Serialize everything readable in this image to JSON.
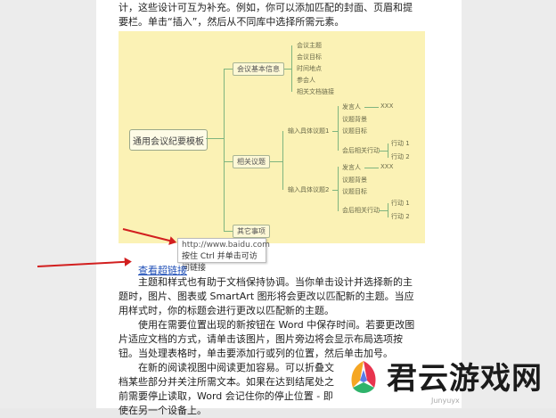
{
  "paragraphs": {
    "p1": "计，这些设计可互为补充。例如，你可以添加匹配的封面、页眉和提要栏。单击“插入”，然后从不同库中选择所需元素。",
    "p2": "主题和样式也有助于文档保持协调。当你单击设计并选择新的主题时，图片、图表或 SmartArt 图形将会更改以匹配新的主题。当应用样式时，你的标题会进行更改以匹配新的主题。",
    "p3": "使用在需要位置出现的新按钮在 Word 中保存时间。若要更改图片适应文档的方式，请单击该图片，图片旁边将会显示布局选项按钮。当处理表格时，单击要添加行或列的位置，然后单击加号。",
    "p4": "在新的阅读视图中阅读更加容易。可以折叠文档某些部分并关注所需文本。如果在达到结尾处之前需要停止读取，Word 会记住你的停止位置 - 即使在另一个设备上。"
  },
  "mindmap": {
    "root": "通用会议纪要模板",
    "branch1": {
      "label": "会议基本信息",
      "items": [
        "会议主题",
        "会议目标",
        "时间地点",
        "参会人",
        "相关文档链接"
      ]
    },
    "branch2": {
      "label": "相关议题",
      "topic1": {
        "label": "输入具体议题1",
        "items": [
          "发言人",
          "议题背景",
          "议题目标",
          "会后相关行动"
        ],
        "speaker_value": "XXX",
        "actions": [
          "行动 1",
          "行动 2"
        ]
      },
      "topic2": {
        "label": "输入具体议题2",
        "items": [
          "发言人",
          "议题背景",
          "议题目标",
          "会后相关行动"
        ],
        "speaker_value": "XXX",
        "actions": [
          "行动 1",
          "行动 2"
        ]
      }
    },
    "branch3": {
      "label": "其它事项"
    }
  },
  "tooltip": {
    "url": "http://www.baidu.com",
    "hint": "按住 Ctrl 并单击可访问链接"
  },
  "link_text": "查看超链接",
  "watermark": {
    "brand": "君云游戏网",
    "sub": "Junyuyx"
  },
  "colors": {
    "mindmap_bg": "#fbf2b5",
    "link": "#1f4fb7",
    "arrow": "#d21f1f"
  }
}
